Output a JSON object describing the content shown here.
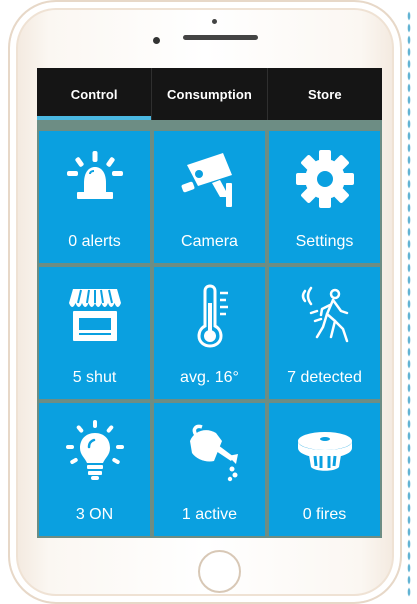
{
  "tabs": [
    {
      "label": "Control",
      "active": true
    },
    {
      "label": "Consumption",
      "active": false
    },
    {
      "label": "Store",
      "active": false
    }
  ],
  "tiles": [
    {
      "icon": "alarm-light-icon",
      "label": "0 alerts"
    },
    {
      "icon": "camera-icon",
      "label": "Camera"
    },
    {
      "icon": "gear-icon",
      "label": "Settings"
    },
    {
      "icon": "shop-shutter-icon",
      "label": "5 shut"
    },
    {
      "icon": "thermometer-icon",
      "label": "avg. 16°"
    },
    {
      "icon": "motion-sensor-icon",
      "label": "7 detected"
    },
    {
      "icon": "light-bulb-icon",
      "label": "3 ON"
    },
    {
      "icon": "watering-can-icon",
      "label": "1 active"
    },
    {
      "icon": "smoke-detector-icon",
      "label": "0 fires"
    }
  ],
  "colors": {
    "tile": "#0aa0e0",
    "tab_bar": "#151515",
    "tab_indicator": "#4ab8e2",
    "grid_background": "#6d8d84",
    "text": "#ffffff"
  }
}
